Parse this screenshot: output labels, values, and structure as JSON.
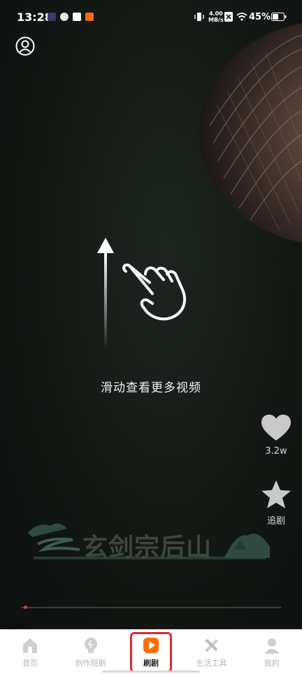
{
  "status_bar": {
    "time": "13:28",
    "net_speed_value": "4.00",
    "net_speed_unit": "MB/s",
    "battery_percent": "45%"
  },
  "video": {
    "swipe_hint": "滑动查看更多视频",
    "like_count": "3.2w",
    "follow_label": "追剧",
    "title_banner": "玄剑宗后山"
  },
  "bottom_nav": {
    "items": [
      {
        "label": "首页",
        "icon": "home-icon"
      },
      {
        "label": "创作短剧",
        "icon": "lightbulb-icon"
      },
      {
        "label": "刷剧",
        "icon": "play-icon"
      },
      {
        "label": "生活工具",
        "icon": "tools-icon"
      },
      {
        "label": "我的",
        "icon": "profile-icon"
      }
    ],
    "active_index": 2
  },
  "colors": {
    "accent_orange": "#ff6a00",
    "highlight_red": "#e0292c",
    "background": "#0f1310"
  }
}
